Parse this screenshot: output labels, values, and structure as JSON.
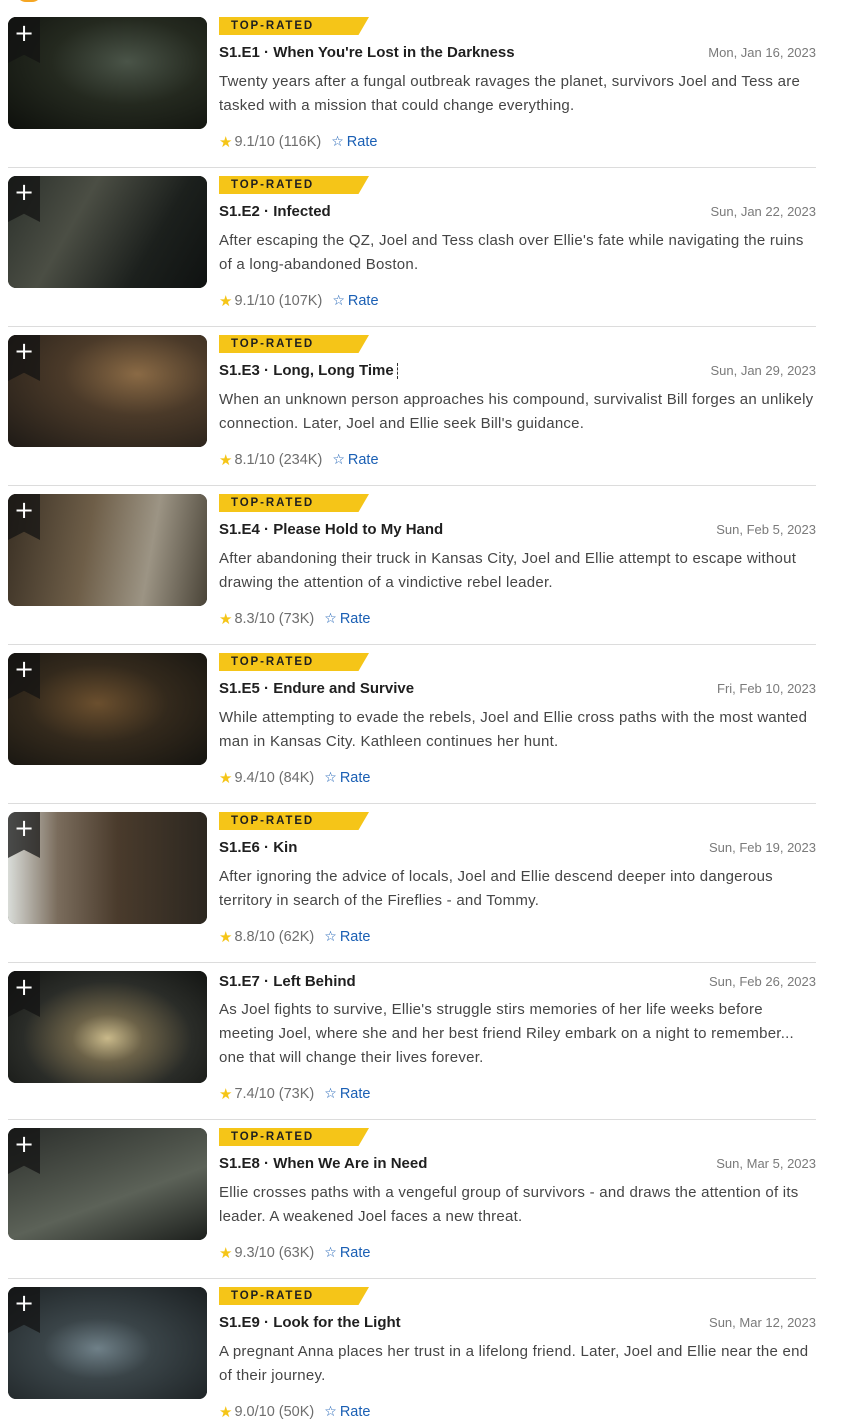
{
  "badge_label": "TOP-RATED",
  "rate_label": "Rate",
  "star_color": "#f5c518",
  "link_color": "#1a5fb4",
  "icons": {
    "add": "plus-icon",
    "rating": "star-filled-icon",
    "rate": "star-outline-icon"
  },
  "episodes": [
    {
      "code": "S1.E1 · When You're Lost in the Darkness",
      "date": "Mon, Jan 16, 2023",
      "top_rated": true,
      "description": "Twenty years after a fungal outbreak ravages the planet, survivors Joel and Tess are tasked with a mission that could change everything.",
      "rating": "9.1/10",
      "votes": "(116K)"
    },
    {
      "code": "S1.E2 · Infected",
      "date": "Sun, Jan 22, 2023",
      "top_rated": true,
      "description": "After escaping the QZ, Joel and Tess clash over Ellie's fate while navigating the ruins of a long-abandoned Boston.",
      "rating": "9.1/10",
      "votes": "(107K)"
    },
    {
      "code": "S1.E3 · Long, Long Time",
      "date": "Sun, Jan 29, 2023",
      "top_rated": true,
      "description": "When an unknown person approaches his compound, survivalist Bill forges an unlikely connection. Later, Joel and Ellie seek Bill's guidance.",
      "rating": "8.1/10",
      "votes": "(234K)"
    },
    {
      "code": "S1.E4 · Please Hold to My Hand",
      "date": "Sun, Feb 5, 2023",
      "top_rated": true,
      "description": "After abandoning their truck in Kansas City, Joel and Ellie attempt to escape without drawing the attention of a vindictive rebel leader.",
      "rating": "8.3/10",
      "votes": "(73K)"
    },
    {
      "code": "S1.E5 · Endure and Survive",
      "date": "Fri, Feb 10, 2023",
      "top_rated": true,
      "description": "While attempting to evade the rebels, Joel and Ellie cross paths with the most wanted man in Kansas City. Kathleen continues her hunt.",
      "rating": "9.4/10",
      "votes": "(84K)"
    },
    {
      "code": "S1.E6 · Kin",
      "date": "Sun, Feb 19, 2023",
      "top_rated": true,
      "description": "After ignoring the advice of locals, Joel and Ellie descend deeper into dangerous territory in search of the Fireflies - and Tommy.",
      "rating": "8.8/10",
      "votes": "(62K)"
    },
    {
      "code": "S1.E7 · Left Behind",
      "date": "Sun, Feb 26, 2023",
      "top_rated": false,
      "description": "As Joel fights to survive, Ellie's struggle stirs memories of her life weeks before meeting Joel, where she and her best friend Riley embark on a night to remember... one that will change their lives forever.",
      "rating": "7.4/10",
      "votes": "(73K)"
    },
    {
      "code": "S1.E8 · When We Are in Need",
      "date": "Sun, Mar 5, 2023",
      "top_rated": true,
      "description": "Ellie crosses paths with a vengeful group of survivors - and draws the attention of its leader. A weakened Joel faces a new threat.",
      "rating": "9.3/10",
      "votes": "(63K)"
    },
    {
      "code": "S1.E9 · Look for the Light",
      "date": "Sun, Mar 12, 2023",
      "top_rated": true,
      "description": "A pregnant Anna places her trust in a lifelong friend. Later, Joel and Ellie near the end of their journey.",
      "rating": "9.0/10",
      "votes": "(50K)"
    }
  ]
}
